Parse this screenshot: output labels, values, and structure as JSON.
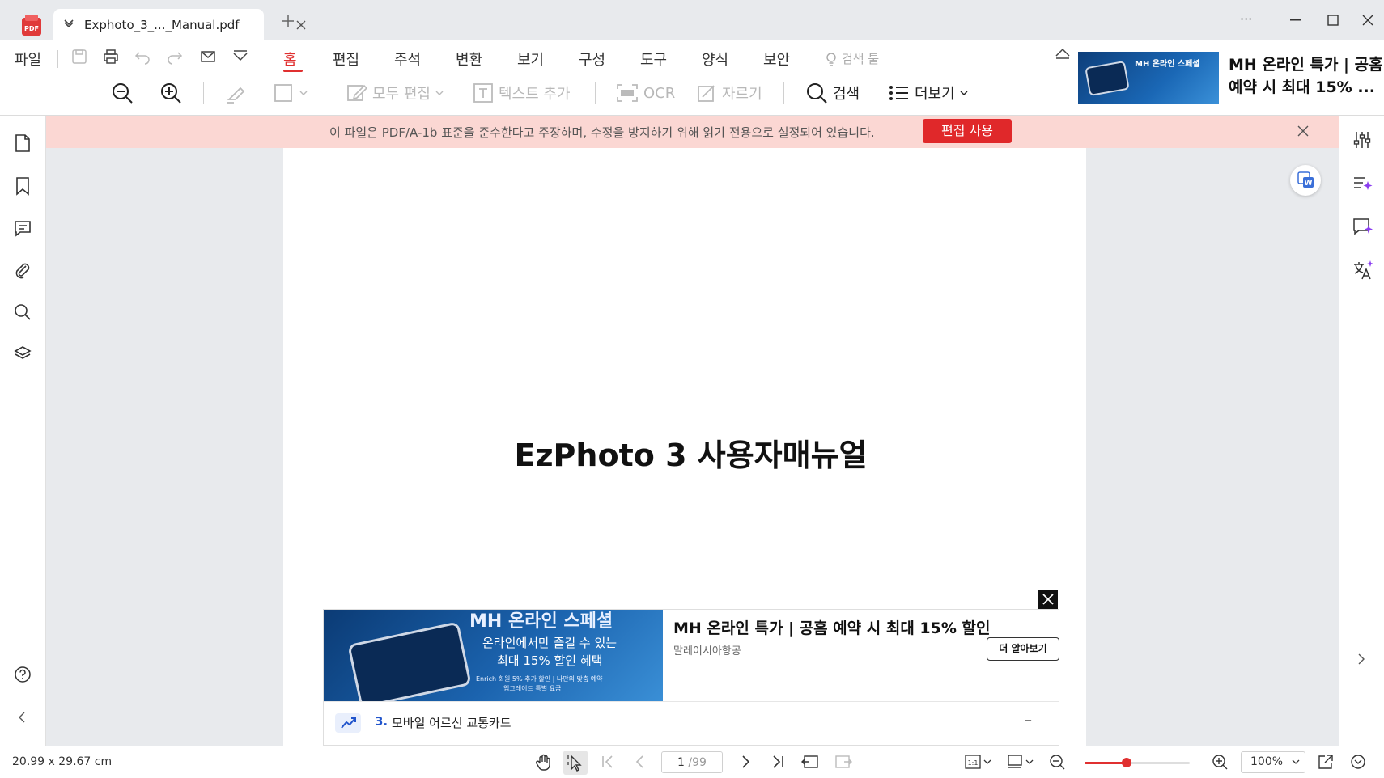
{
  "window": {
    "tab_title": "Exphoto_3_..._Manual.pdf",
    "new_tab_symbol": "+",
    "more_symbol": "···"
  },
  "menu": {
    "file": "파일",
    "items": [
      "홈",
      "편집",
      "주석",
      "변환",
      "보기",
      "구성",
      "도구",
      "양식",
      "보안"
    ],
    "active": "홈",
    "search_tool": "검색 툴"
  },
  "toolbar": {
    "edit_all": "모두 편집",
    "add_text": "텍스트 추가",
    "ocr": "OCR",
    "crop": "자르기",
    "search": "검색",
    "more": "더보기"
  },
  "ribbon_ad": {
    "image_caption": "MH 온라인 스페셜",
    "title": "MH 온라인 특가 | 공홈 예약 시 최대 15% ..."
  },
  "banner": {
    "message": "이 파일은 PDF/A-1b 표준을 준수한다고 주장하며, 수정을 방지하기 위해 읽기 전용으로 설정되어 있습니다.",
    "button": "편집 사용"
  },
  "document": {
    "title": "EzPhoto 3 사용자매뉴얼"
  },
  "page_ad": {
    "image_line1": "MH 온라인 스페셜",
    "image_line2": "온라인에서만 즐길 수 있는",
    "image_line3": "최대 15% 할인 혜택",
    "image_line4": "Enrich 회원 5% 추가 할인 | 나만의 맞춤 예약",
    "image_line5": "업그레이드 특별 요금",
    "headline": "MH 온라인 특가 | 공홈 예약 시 최대 15% 할인",
    "advertiser": "말레이시아항공",
    "cta": "더 알아보기",
    "related_num": "3.",
    "related_text": "모바일 어르신 교통카드",
    "collapse_symbol": "–"
  },
  "status": {
    "page_size": "20.99 x 29.67 cm",
    "current_page": "1",
    "total_pages": "/99",
    "zoom": "100%",
    "zoom_level": 0.4
  },
  "colors": {
    "accent": "#e03030",
    "banner_bg": "#fbd7d3",
    "link_blue": "#2255cc"
  }
}
